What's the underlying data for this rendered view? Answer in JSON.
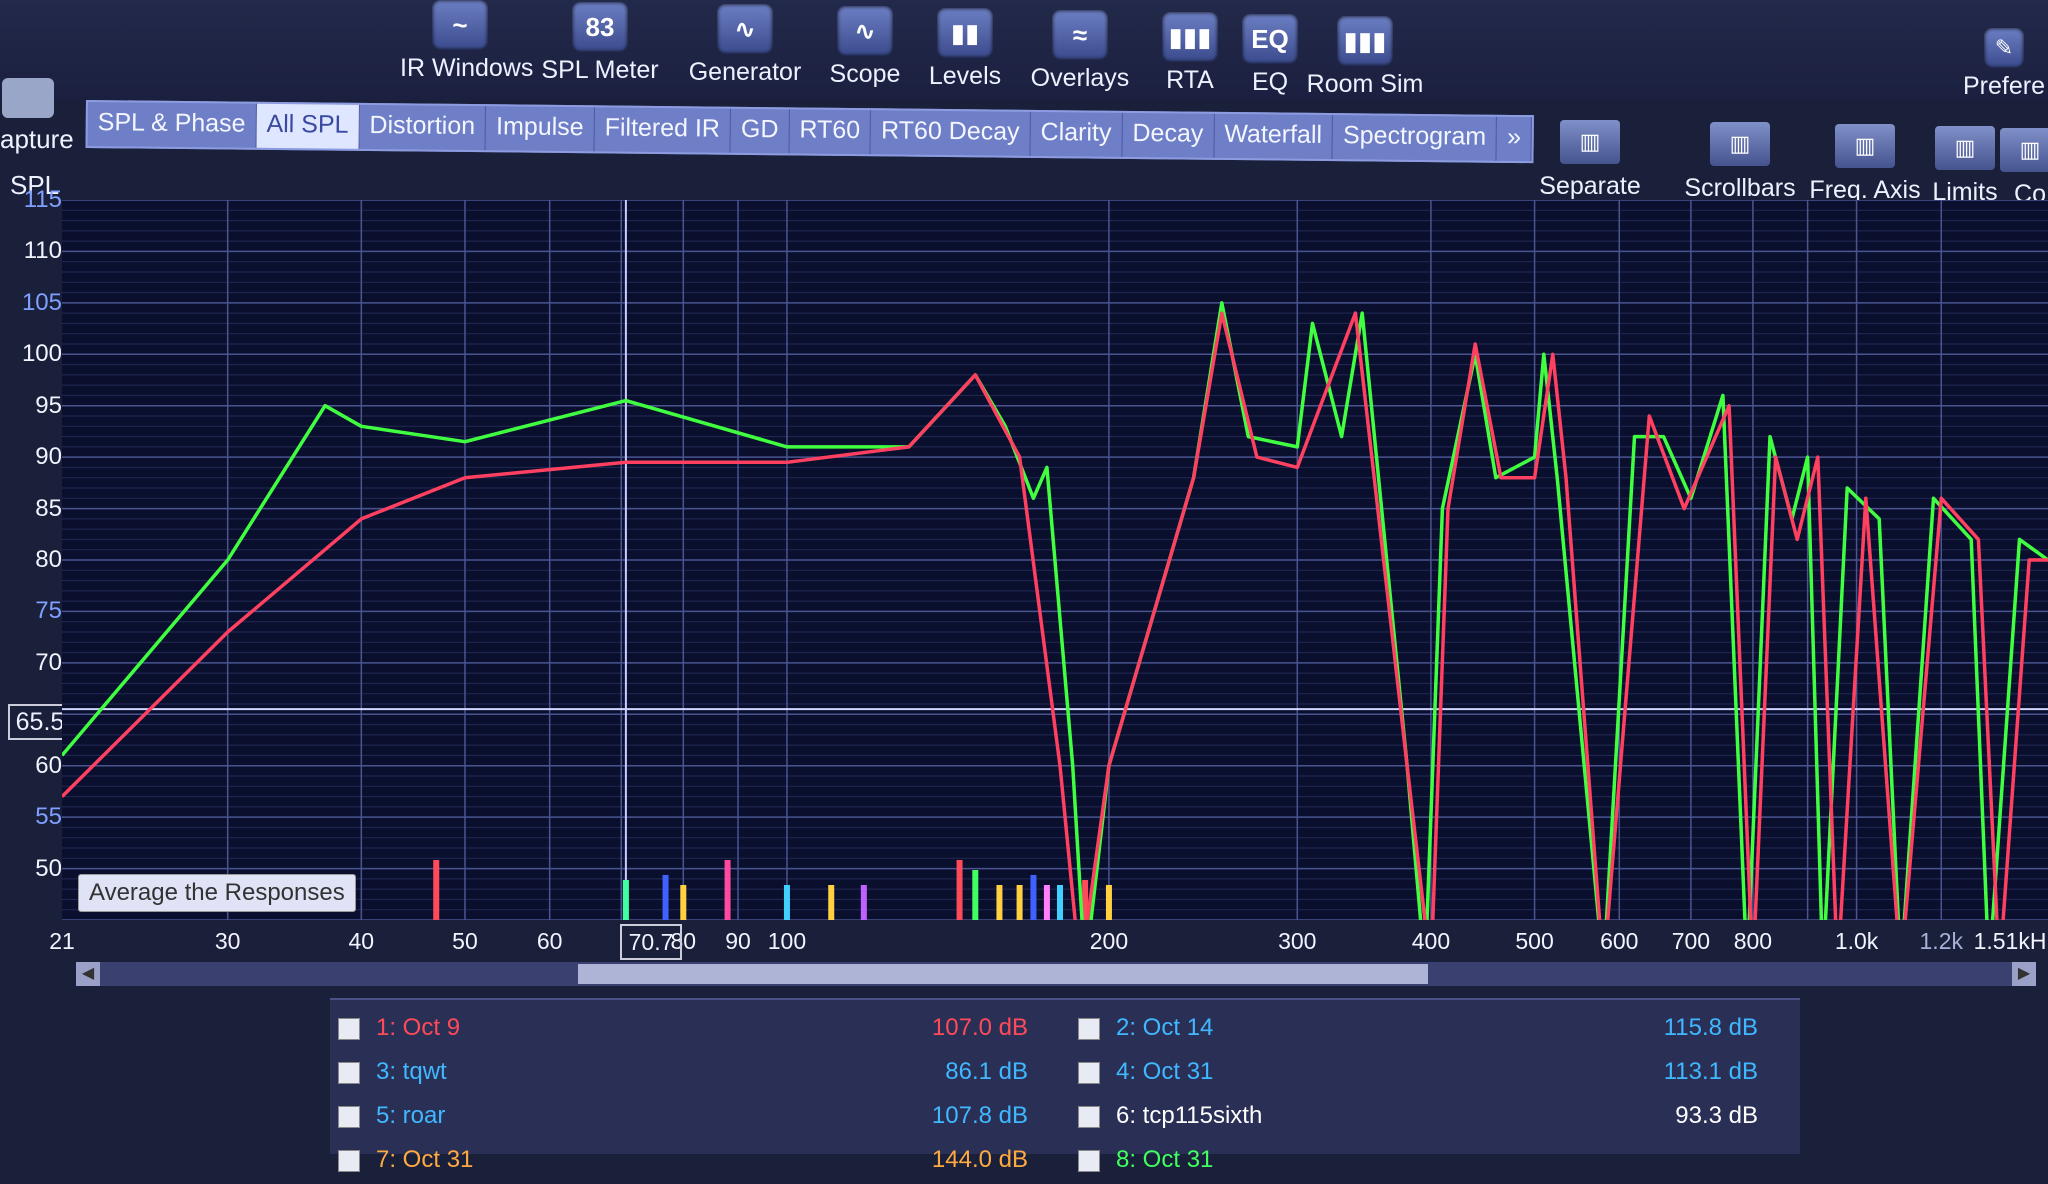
{
  "toolbar": {
    "tools": [
      {
        "label": "IR Windows",
        "icon": "ir-windows-icon",
        "glyph": "~"
      },
      {
        "label": "SPL Meter",
        "icon": "spl-meter-icon",
        "glyph": "83"
      },
      {
        "label": "Generator",
        "icon": "generator-icon",
        "glyph": "∿"
      },
      {
        "label": "Scope",
        "icon": "scope-icon",
        "glyph": "∿"
      },
      {
        "label": "Levels",
        "icon": "levels-icon",
        "glyph": "▮▮"
      },
      {
        "label": "Overlays",
        "icon": "overlays-icon",
        "glyph": "≈"
      },
      {
        "label": "RTA",
        "icon": "rta-icon",
        "glyph": "▮▮▮"
      },
      {
        "label": "EQ",
        "icon": "eq-icon",
        "glyph": "EQ"
      },
      {
        "label": "Room Sim",
        "icon": "room-sim-icon",
        "glyph": "▮▮▮"
      }
    ],
    "preferences_label": "Prefere",
    "capture_label": "apture"
  },
  "tabs": [
    "SPL & Phase",
    "All SPL",
    "Distortion",
    "Impulse",
    "Filtered IR",
    "GD",
    "RT60",
    "RT60 Decay",
    "Clarity",
    "Decay",
    "Waterfall",
    "Spectrogram",
    "»"
  ],
  "active_tab": "All SPL",
  "right_tools": [
    {
      "label": "Separate",
      "icon": "separate-icon"
    },
    {
      "label": "Scrollbars",
      "icon": "scrollbars-icon"
    },
    {
      "label": "Freq. Axis",
      "icon": "freq-axis-icon"
    },
    {
      "label": "Limits",
      "icon": "limits-icon"
    },
    {
      "label": "Co",
      "icon": "controls-icon"
    }
  ],
  "y_axis": {
    "label": "SPL",
    "ticks": [
      "115",
      "110",
      "105",
      "100",
      "95",
      "90",
      "85",
      "80",
      "75",
      "70",
      "60",
      "55",
      "50"
    ],
    "cursor_value": "65.5"
  },
  "x_axis": {
    "ticks": [
      "21",
      "30",
      "40",
      "50",
      "60",
      "80",
      "90",
      "100",
      "200",
      "300",
      "400",
      "500",
      "600",
      "700",
      "800",
      "1.0k",
      "1.2k",
      "1.51kH"
    ],
    "cursor_value": "70.7"
  },
  "average_button": "Average the Responses",
  "legend": [
    {
      "name": "1: Oct 9",
      "value": "107.0 dB",
      "color": "#ff4a5a"
    },
    {
      "name": "2: Oct 14",
      "value": "115.8 dB",
      "color": "#40b8ff"
    },
    {
      "name": "3: tqwt",
      "value": "86.1 dB",
      "color": "#40b8ff"
    },
    {
      "name": "4: Oct 31",
      "value": "113.1 dB",
      "color": "#40b8ff"
    },
    {
      "name": "5: roar",
      "value": "107.8 dB",
      "color": "#40b8ff"
    },
    {
      "name": "6: tcp115sixth",
      "value": "93.3 dB",
      "color": "#ffffff"
    },
    {
      "name": "7: Oct 31",
      "value": "144.0 dB",
      "color": "#ffaa40"
    },
    {
      "name": "8: Oct 31",
      "value": "",
      "color": "#40ff60"
    }
  ],
  "chart_data": {
    "type": "line",
    "ylabel": "SPL",
    "ylim": [
      45,
      115
    ],
    "xlim": [
      21,
      1510
    ],
    "x_scale": "log",
    "grid": true,
    "series": [
      {
        "color": "#40ff40",
        "points": [
          [
            21,
            61
          ],
          [
            30,
            80
          ],
          [
            37,
            95
          ],
          [
            40,
            93
          ],
          [
            50,
            91.5
          ],
          [
            70.7,
            95.5
          ],
          [
            100,
            91
          ],
          [
            130,
            91
          ],
          [
            150,
            98
          ],
          [
            160,
            93
          ],
          [
            170,
            86
          ],
          [
            175,
            89
          ],
          [
            185,
            60
          ],
          [
            190,
            40
          ],
          [
            200,
            60
          ],
          [
            240,
            88
          ],
          [
            255,
            105
          ],
          [
            270,
            92
          ],
          [
            300,
            91
          ],
          [
            310,
            103
          ],
          [
            330,
            92
          ],
          [
            345,
            104
          ],
          [
            380,
            60
          ],
          [
            395,
            40
          ],
          [
            410,
            85
          ],
          [
            440,
            100
          ],
          [
            460,
            88
          ],
          [
            500,
            90
          ],
          [
            510,
            100
          ],
          [
            525,
            88
          ],
          [
            580,
            40
          ],
          [
            620,
            92
          ],
          [
            660,
            92
          ],
          [
            700,
            86
          ],
          [
            750,
            96
          ],
          [
            790,
            40
          ],
          [
            830,
            92
          ],
          [
            870,
            84
          ],
          [
            900,
            90
          ],
          [
            930,
            40
          ],
          [
            980,
            87
          ],
          [
            1050,
            84
          ],
          [
            1100,
            40
          ],
          [
            1180,
            86
          ],
          [
            1280,
            82
          ],
          [
            1330,
            40
          ],
          [
            1420,
            82
          ],
          [
            1510,
            80
          ]
        ]
      },
      {
        "color": "#ff4060",
        "points": [
          [
            21,
            57
          ],
          [
            30,
            73
          ],
          [
            40,
            84
          ],
          [
            50,
            88
          ],
          [
            70.7,
            89.5
          ],
          [
            100,
            89.5
          ],
          [
            130,
            91
          ],
          [
            150,
            98
          ],
          [
            165,
            90
          ],
          [
            180,
            60
          ],
          [
            188,
            40
          ],
          [
            200,
            60
          ],
          [
            240,
            88
          ],
          [
            255,
            104
          ],
          [
            275,
            90
          ],
          [
            300,
            89
          ],
          [
            340,
            104
          ],
          [
            380,
            60
          ],
          [
            400,
            40
          ],
          [
            415,
            85
          ],
          [
            440,
            101
          ],
          [
            465,
            88
          ],
          [
            500,
            88
          ],
          [
            520,
            100
          ],
          [
            535,
            88
          ],
          [
            580,
            40
          ],
          [
            640,
            94
          ],
          [
            690,
            85
          ],
          [
            760,
            95
          ],
          [
            800,
            40
          ],
          [
            840,
            90
          ],
          [
            880,
            82
          ],
          [
            920,
            90
          ],
          [
            960,
            40
          ],
          [
            1020,
            86
          ],
          [
            1100,
            40
          ],
          [
            1200,
            86
          ],
          [
            1300,
            82
          ],
          [
            1360,
            40
          ],
          [
            1450,
            80
          ],
          [
            1510,
            80
          ]
        ]
      }
    ]
  }
}
